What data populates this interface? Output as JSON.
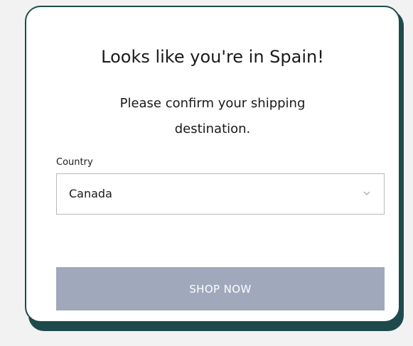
{
  "modal": {
    "title": "Looks like you're in Spain!",
    "subtitle": "Please confirm your shipping destination.",
    "country_field": {
      "label": "Country",
      "selected_value": "Canada",
      "icon": "chevron-down-icon"
    },
    "submit_label": "SHOP NOW"
  },
  "colors": {
    "page_background": "#f2f2f2",
    "modal_border": "#1f4a4c",
    "button_background": "#a0a8bc",
    "button_text": "#ffffff"
  }
}
